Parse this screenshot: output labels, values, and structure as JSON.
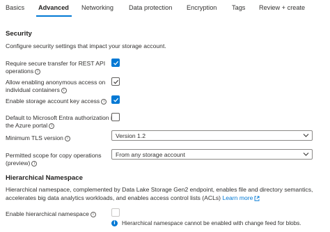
{
  "tabs": [
    {
      "label": "Basics",
      "active": false
    },
    {
      "label": "Advanced",
      "active": true
    },
    {
      "label": "Networking",
      "active": false
    },
    {
      "label": "Data protection",
      "active": false
    },
    {
      "label": "Encryption",
      "active": false
    },
    {
      "label": "Tags",
      "active": false
    },
    {
      "label": "Review + create",
      "active": false
    }
  ],
  "security": {
    "title": "Security",
    "description": "Configure security settings that impact your storage account.",
    "settings": [
      {
        "label": "Require secure transfer for REST API\noperations",
        "checked": true,
        "disabled": false
      },
      {
        "label": "Allow enabling anonymous access on\nindividual containers",
        "checked": true,
        "disabled": false
      },
      {
        "label": "Enable storage account key access",
        "checked": true,
        "disabled": false
      },
      {
        "label": "Default to Microsoft Entra authorization in\nthe Azure portal",
        "checked": false,
        "disabled": false
      }
    ],
    "min_tls": {
      "label": "Minimum TLS version",
      "value": "Version 1.2"
    },
    "copy_scope": {
      "label": "Permitted scope for copy operations\n(preview)",
      "value": "From any storage account"
    }
  },
  "hns": {
    "title": "Hierarchical Namespace",
    "description_line1": "Hierarchical namespace, complemented by Data Lake Storage Gen2 endpoint, enables file and directory semantics,",
    "description_line2": "accelerates big data analytics workloads, and enables access control lists (ACLs)",
    "learn_more": "Learn more",
    "enable_label": "Enable hierarchical namespace",
    "enable_checked": false,
    "enable_disabled": true,
    "note": "Hierarchical namespace cannot be enabled with change feed for blobs."
  },
  "colors": {
    "accent": "#0078d4",
    "text": "#323130",
    "border": "#8a8886"
  },
  "icons": {
    "info": "info-icon",
    "chevron": "chevron-down-icon",
    "external": "external-link-icon",
    "check": "checkmark-icon"
  }
}
